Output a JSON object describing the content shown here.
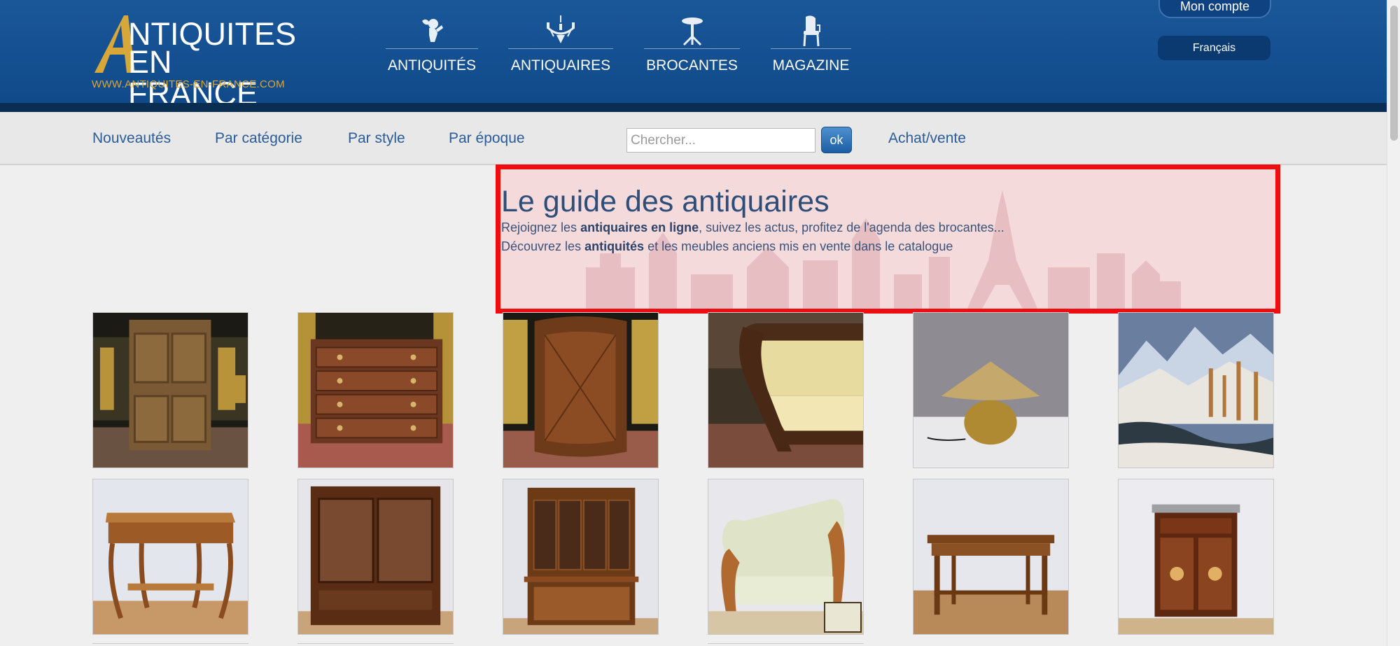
{
  "logo": {
    "line1": "NTIQUITES",
    "line2": "EN FRANCE",
    "url": "WWW.ANTIQUITES-EN-FRANCE.COM",
    "letter_a": "A",
    "colors": {
      "gold": "#d7a73a",
      "white": "#ffffff"
    }
  },
  "main_nav": [
    {
      "label": "ANTIQUITÉS",
      "icon": "cherub-icon"
    },
    {
      "label": "ANTIQUAIRES",
      "icon": "chandelier-icon"
    },
    {
      "label": "BROCANTES",
      "icon": "pedestal-table-icon"
    },
    {
      "label": "MAGAZINE",
      "icon": "chair-icon"
    }
  ],
  "account": {
    "label": "Mon compte"
  },
  "language": {
    "label": "Français"
  },
  "subnav": {
    "links": [
      "Nouveautés",
      "Par catégorie",
      "Par style",
      "Par époque"
    ],
    "search_placeholder": "Chercher...",
    "search_button": "ok",
    "buy_sell": "Achat/vente"
  },
  "guide": {
    "title": "Le guide des antiquaires",
    "line1_prefix": "Rejoignez les ",
    "line1_bold": "antiquaires en ligne",
    "line1_suffix": ", suivez les actus, profitez de l'agenda des brocantes...",
    "line2_prefix": "Découvrez les ",
    "line2_bold": "antiquités",
    "line2_suffix": " et les meubles anciens mis en vente dans le catalogue"
  },
  "colors": {
    "header_blue": "#104a8a",
    "header_dark_band": "#0a2d52",
    "link_blue": "#2a5c98",
    "highlight_red": "#ee0d11",
    "highlight_fill": "#f4dadb"
  },
  "products": [
    {
      "name": "product-carved-wooden-cabinet",
      "icon": "cabinet"
    },
    {
      "name": "product-chest-of-drawers",
      "icon": "commode"
    },
    {
      "name": "product-round-corner-cabinet",
      "icon": "corner-cabinet"
    },
    {
      "name": "product-carved-daybed",
      "icon": "daybed"
    },
    {
      "name": "product-table-lamp",
      "icon": "lamp"
    },
    {
      "name": "product-winter-landscape-painting",
      "icon": "painting"
    },
    {
      "name": "product-louis-xv-side-table",
      "icon": "side-table"
    },
    {
      "name": "product-glass-display-cabinet",
      "icon": "vitrine"
    },
    {
      "name": "product-bookcase-buffet",
      "icon": "bookcase"
    },
    {
      "name": "product-upholstered-armchair",
      "icon": "armchair"
    },
    {
      "name": "product-farmhouse-table",
      "icon": "table"
    },
    {
      "name": "product-small-burl-cabinet",
      "icon": "small-cabinet"
    }
  ]
}
